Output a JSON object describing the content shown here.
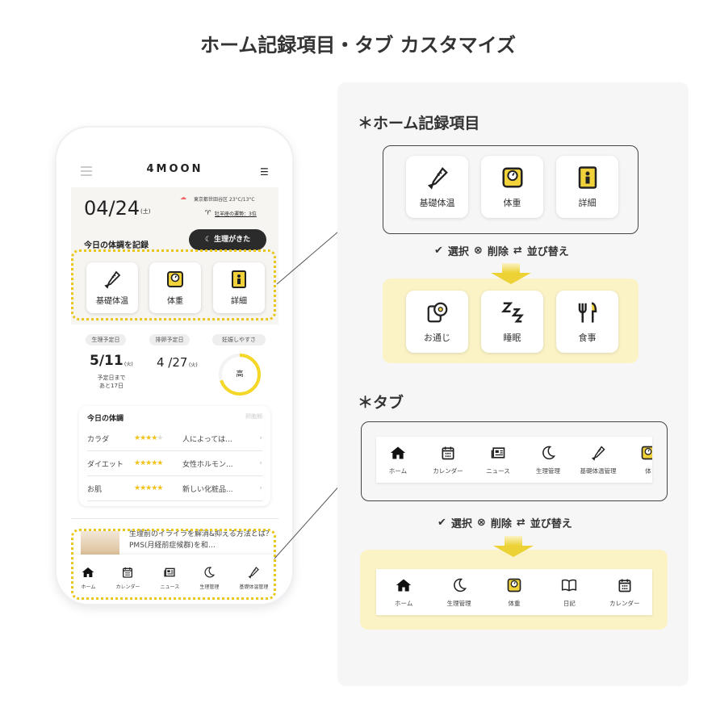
{
  "title": "ホーム記録項目・タブ カスタマイズ",
  "phone": {
    "logo": "4MOON",
    "date": "04/24",
    "weekday": "(土)",
    "weather": "東京都世田谷区 23°C/13°C",
    "horoscope": "牡羊座の運勢：3位",
    "period_button": "生理がきた",
    "record_heading": "今日の体調を記録",
    "record_items": [
      "基礎体温",
      "体重",
      "詳細"
    ],
    "pills": [
      "生理予定日",
      "排卵予定日",
      "妊娠しやすさ"
    ],
    "period_date": "5/11",
    "period_wd": "(火)",
    "period_note1": "予定日まで",
    "period_note2": "あと17日",
    "ovu_date": "4 /27",
    "ovu_wd": "(火)",
    "fertility": "高",
    "fertility_level": 0.7,
    "condition_title": "今日の体調",
    "condition_phase": "卵胞期",
    "conditions": [
      {
        "label": "カラダ",
        "stars": 4,
        "text": "人によっては..."
      },
      {
        "label": "ダイエット",
        "stars": 5,
        "text": "女性ホルモン..."
      },
      {
        "label": "お肌",
        "stars": 5,
        "text": "新しい化粧品..."
      }
    ],
    "article": "生理前のイライラを解消&抑える方法とは？PMS(月経前症候群)を和…",
    "tabs": [
      "ホーム",
      "カレンダー",
      "ニュース",
      "生理管理",
      "基礎体温管理"
    ]
  },
  "home_section": {
    "heading": "＊ホーム記録項目",
    "before": [
      "基礎体温",
      "体重",
      "詳細"
    ],
    "after": [
      "お通じ",
      "睡眠",
      "食事"
    ]
  },
  "actions": {
    "select": "選択",
    "delete": "削除",
    "reorder": "並び替え"
  },
  "tab_section": {
    "heading": "＊タブ",
    "before": [
      "ホーム",
      "カレンダー",
      "ニュース",
      "生理管理",
      "基礎体温管理",
      "体"
    ],
    "after": [
      "ホーム",
      "生理管理",
      "体重",
      "日記",
      "カレンダー"
    ]
  },
  "colors": {
    "accent": "#ecd235",
    "highlight_bg": "#fbf3c6",
    "dark": "#222222"
  }
}
